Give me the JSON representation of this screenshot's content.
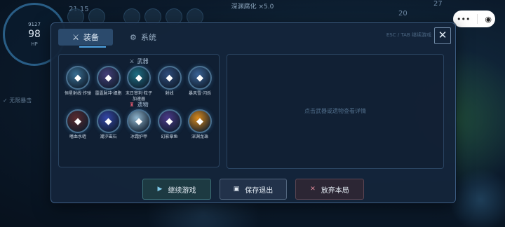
{
  "hud": {
    "top_title": "深渊腐化 ×5.0",
    "stat_left": "21.15",
    "stat_mid": "20",
    "stat_right": "27",
    "gauge_top": "9127",
    "gauge_value": "98",
    "gauge_sub": "HP",
    "side_text": "✓ 无限暴击"
  },
  "tabs": [
    {
      "label": "装备",
      "icon": "crossed-swords-icon"
    },
    {
      "label": "系统",
      "icon": "gear-icon"
    }
  ],
  "hint": "ESC / TAB 继续游戏",
  "weapons": {
    "title": "武器",
    "items": [
      {
        "label": "恒星射线·炸弹",
        "color": "#3a6f93",
        "icon": "star-ray-icon"
      },
      {
        "label": "雷霆脉冲·细胞",
        "color": "#45407a",
        "icon": "thunder-pulse-icon"
      },
      {
        "label": "末日审判·粒子加速器",
        "color": "#1e6f84",
        "icon": "judgement-icon"
      },
      {
        "label": "射线",
        "color": "#2f4d7c",
        "icon": "ray-icon"
      },
      {
        "label": "暴风雪·闪烁",
        "color": "#3a6396",
        "icon": "blizzard-icon"
      }
    ]
  },
  "relics": {
    "title": "遗物",
    "items": [
      {
        "label": "嗜血水蛭",
        "color": "#5a2b2f",
        "icon": "leech-icon"
      },
      {
        "label": "潮汐磁石",
        "color": "#3447a8",
        "icon": "tide-magnet-icon"
      },
      {
        "label": "冰霜护甲",
        "color": "#8fb6cf",
        "icon": "frost-armor-icon"
      },
      {
        "label": "幻影章鱼",
        "color": "#4b3a8a",
        "icon": "octopus-icon"
      },
      {
        "label": "深渊龙珠",
        "color": "#d98a1c",
        "icon": "dragon-orb-icon"
      }
    ]
  },
  "detail_placeholder": "点击武器或遗物查看详情",
  "buttons": {
    "continue": "继续游戏",
    "save_exit": "保存退出",
    "abandon": "放弃本局"
  }
}
